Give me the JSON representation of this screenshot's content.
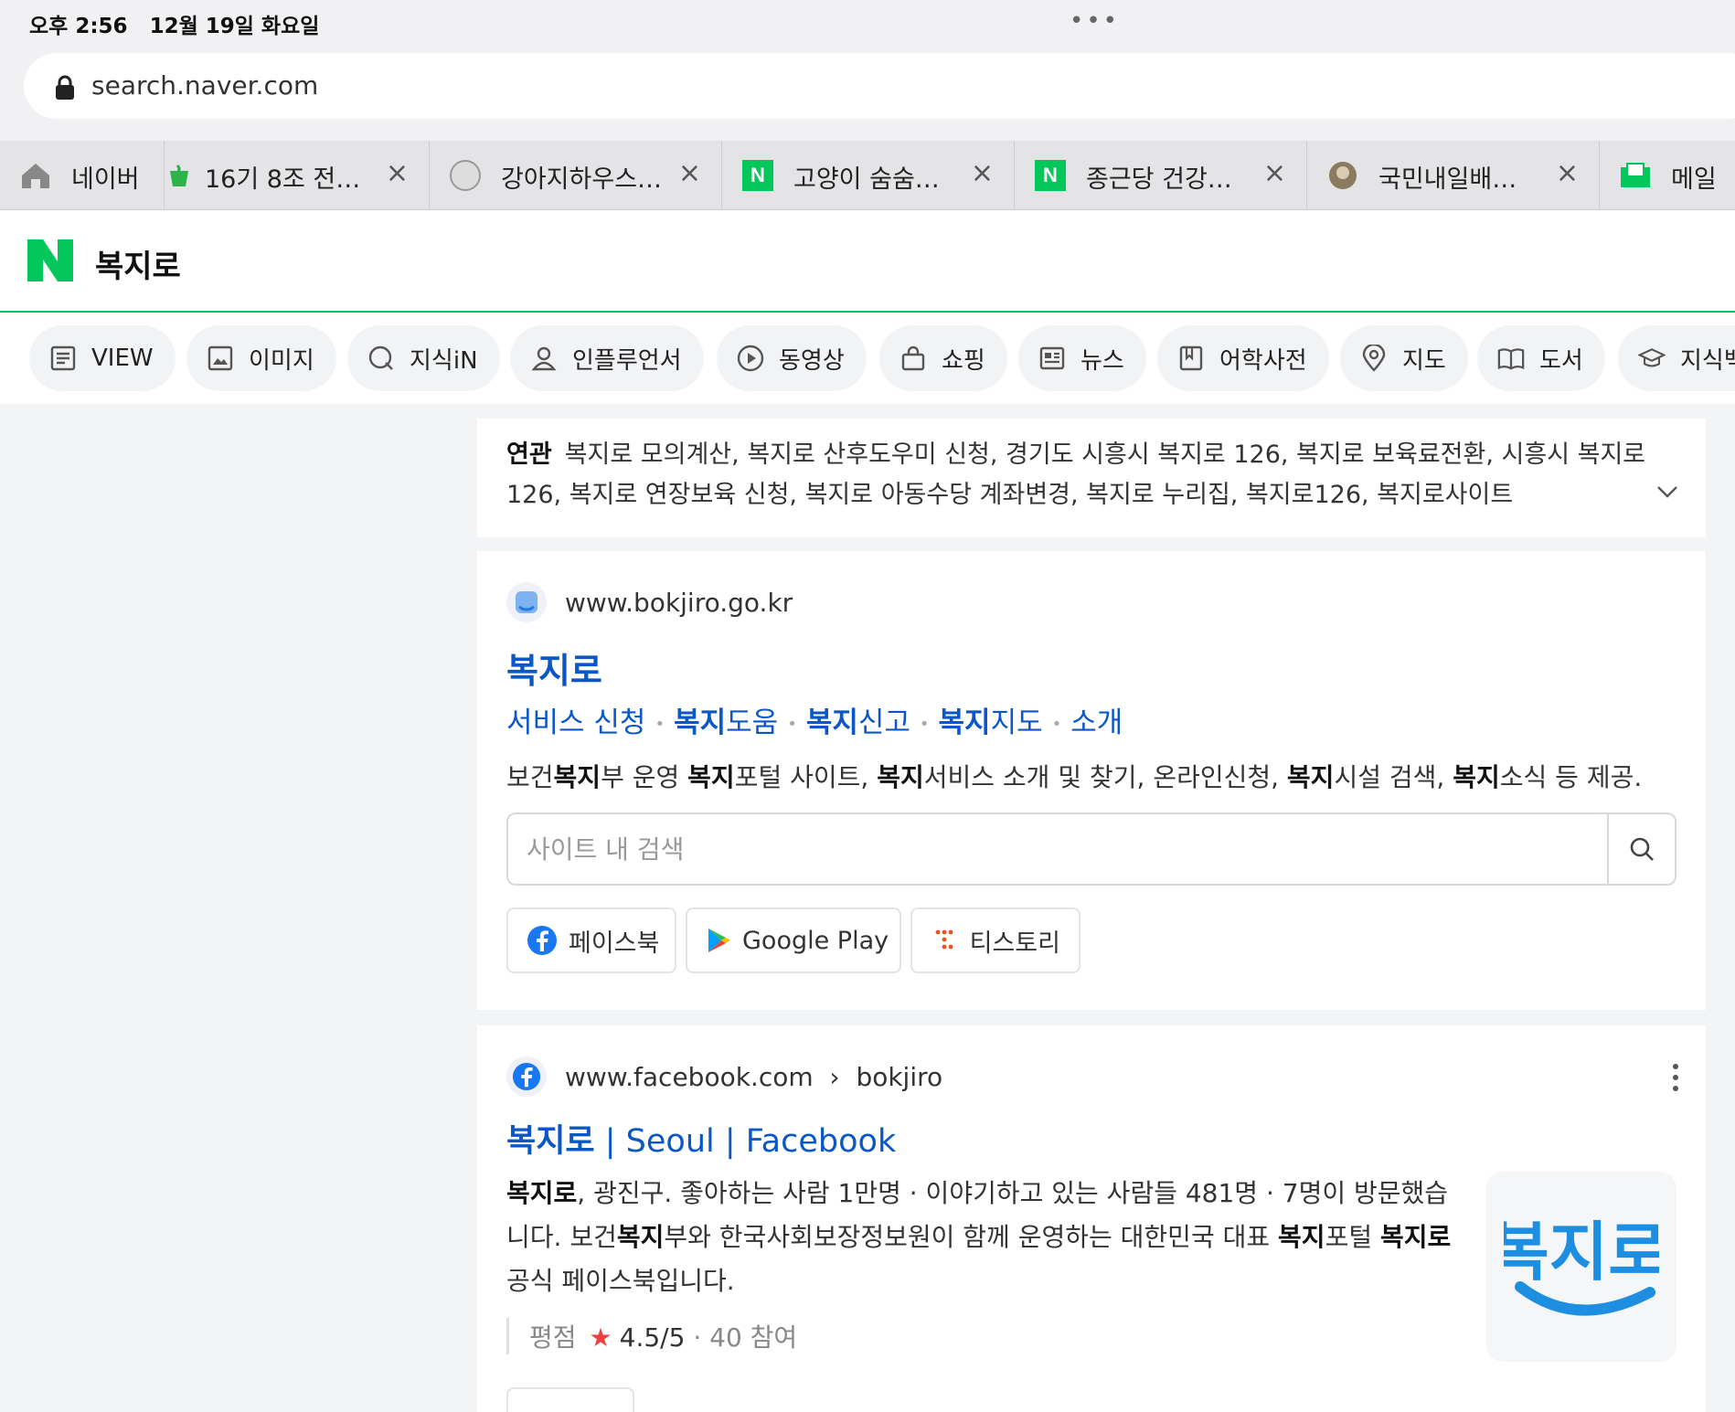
{
  "status": {
    "time": "오후 2:56",
    "date": "12월 19일 화요일"
  },
  "browser": {
    "url": "search.naver.com",
    "tabs": [
      {
        "title": "네이버",
        "icon": "home-icon"
      },
      {
        "title": "16기 8조 전…",
        "icon": "green-cup-icon"
      },
      {
        "title": "강아지하우스…",
        "icon": "dog-house-icon"
      },
      {
        "title": "고양이 숨숨…",
        "icon": "naver-n-icon"
      },
      {
        "title": "종근당 건강…",
        "icon": "naver-n-icon"
      },
      {
        "title": "국민내일배…",
        "icon": "brain-icon"
      },
      {
        "title": "메일",
        "icon": "mail-icon"
      }
    ]
  },
  "search": {
    "query": "복지로",
    "brand_color": "#03c75a",
    "categories": [
      {
        "label": "VIEW",
        "icon": "view-icon"
      },
      {
        "label": "이미지",
        "icon": "image-icon"
      },
      {
        "label": "지식iN",
        "icon": "kin-icon"
      },
      {
        "label": "인플루언서",
        "icon": "person-icon"
      },
      {
        "label": "동영상",
        "icon": "play-icon"
      },
      {
        "label": "쇼핑",
        "icon": "shopping-bag-icon"
      },
      {
        "label": "뉴스",
        "icon": "news-icon"
      },
      {
        "label": "어학사전",
        "icon": "dictionary-icon"
      },
      {
        "label": "지도",
        "icon": "map-pin-icon"
      },
      {
        "label": "도서",
        "icon": "book-icon"
      },
      {
        "label": "지식백",
        "icon": "graduation-cap-icon"
      }
    ]
  },
  "related": {
    "label": "연관",
    "text": "복지로 모의계산, 복지로 산후도우미 신청, 경기도 시흥시 복지로 126, 복지로 보육료전환, 시흥시 복지로 126, 복지로 연장보육 신청, 복지로 아동수당 계좌변경, 복지로 누리집, 복지로126, 복지로사이트"
  },
  "result1": {
    "site_url": "www.bokjiro.go.kr",
    "title": "복지로",
    "sublinks": [
      {
        "bold": "",
        "rest": "서비스 신청"
      },
      {
        "bold": "복지",
        "rest": "도움"
      },
      {
        "bold": "복지",
        "rest": "신고"
      },
      {
        "bold": "복지",
        "rest": "지도"
      },
      {
        "bold": "",
        "rest": "소개"
      }
    ],
    "description": [
      {
        "t": "보건",
        "b": false
      },
      {
        "t": "복지",
        "b": true
      },
      {
        "t": "부 운영 ",
        "b": false
      },
      {
        "t": "복지",
        "b": true
      },
      {
        "t": "포털 사이트, ",
        "b": false
      },
      {
        "t": "복지",
        "b": true
      },
      {
        "t": "서비스 소개 및 찾기, 온라인신청, ",
        "b": false
      },
      {
        "t": "복지",
        "b": true
      },
      {
        "t": "시설 검색, ",
        "b": false
      },
      {
        "t": "복지",
        "b": true
      },
      {
        "t": "소식 등 제공.",
        "b": false
      }
    ],
    "site_search_placeholder": "사이트 내 검색",
    "social_links": [
      {
        "label": "페이스북",
        "icon": "facebook-icon"
      },
      {
        "label": "Google Play",
        "icon": "google-play-icon"
      },
      {
        "label": "티스토리",
        "icon": "tistory-icon"
      }
    ]
  },
  "result2": {
    "site_url": "www.facebook.com",
    "breadcrumb": "bokjiro",
    "title_bold": "복지로",
    "title_rest": " | Seoul | Facebook",
    "description": [
      {
        "t": "복지로",
        "b": true
      },
      {
        "t": ", 광진구. 좋아하는 사람 1만명 · 이야기하고 있는 사람들 481명 · 7명이 방문했습니다. 보건",
        "b": false
      },
      {
        "t": "복지",
        "b": true
      },
      {
        "t": "부와 한국사회보장정보원이 함께 운영하는 대한민국 대표 ",
        "b": false
      },
      {
        "t": "복지",
        "b": true
      },
      {
        "t": "포털 ",
        "b": false
      },
      {
        "t": "복지로",
        "b": true
      },
      {
        "t": " 공식 페이스북입니다.",
        "b": false
      }
    ],
    "rating_label": "평점",
    "rating_score": "4.5/5",
    "rating_count": "40 참여",
    "thumbnail_text": "복지로"
  }
}
